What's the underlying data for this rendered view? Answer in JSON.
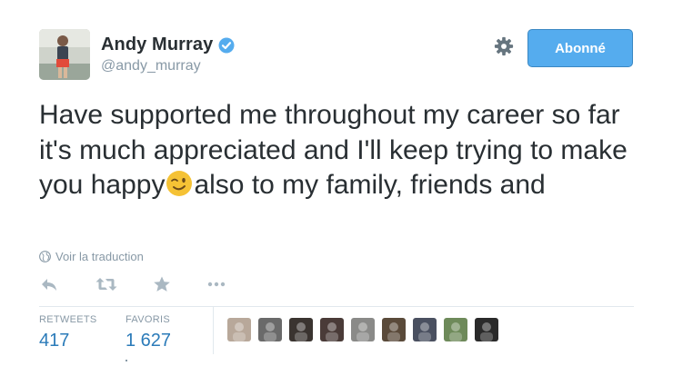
{
  "user": {
    "display_name": "Andy Murray",
    "handle": "@andy_murray",
    "verified": true,
    "avatar_icon": "profile-photo"
  },
  "follow_button": {
    "label": "Abonné",
    "bg": "#55acee"
  },
  "tweet": {
    "text_before_emoji": "Have supported me throughout my career so far it's much appreciated and I'll keep trying to make you happy",
    "emoji": "winking-face-emoji",
    "text_after_emoji": "also to my family, friends and"
  },
  "translate_link": "Voir la traduction",
  "actions": [
    "reply-icon",
    "retweet-icon",
    "favorite-star-icon",
    "more-icon"
  ],
  "stats": {
    "retweets": {
      "label": "RETWEETS",
      "value": "417"
    },
    "favorites": {
      "label": "FAVORIS",
      "value": "1 627"
    }
  },
  "favorited_by_avatars": [
    {
      "color": "#b8a89a"
    },
    {
      "color": "#6a6a6a"
    },
    {
      "color": "#3a3430"
    },
    {
      "color": "#4a3b38"
    },
    {
      "color": "#8a8a88"
    },
    {
      "color": "#5a4a3a"
    },
    {
      "color": "#4a5060"
    },
    {
      "color": "#6e8a5a"
    },
    {
      "color": "#2a2a2a"
    }
  ],
  "colors": {
    "link_blue": "#2b7bb9",
    "muted": "#8899a6",
    "text": "#292f33"
  }
}
